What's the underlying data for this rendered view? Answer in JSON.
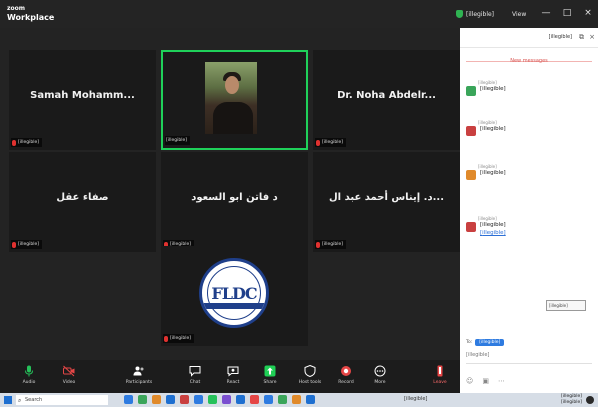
{
  "window": {
    "brand_line1": "zoom",
    "brand_line2": "Workplace",
    "status_text": "[illegible]",
    "view_label": "View",
    "minimize": "—",
    "maximize": "□",
    "close": "×"
  },
  "participants": [
    {
      "name": "Samah Mohamm...",
      "label": "[illegible]",
      "muted": true,
      "active": false
    },
    {
      "name": "",
      "label": "[illegible]",
      "muted": false,
      "active": true,
      "has_video": true
    },
    {
      "name": "Dr. Noha Abdelr...",
      "label": "[illegible]",
      "muted": true,
      "active": false
    },
    {
      "name": "صفاء عقل",
      "label": "[illegible]",
      "muted": true,
      "active": false
    },
    {
      "name": "د فاتن ابو السعود",
      "label": "[illegible]",
      "muted": true,
      "active": false
    },
    {
      "name": "د. إيناس أحمد عبد ال...",
      "label": "[illegible]",
      "muted": true,
      "active": false
    },
    {
      "name": "",
      "label": "[illegible]",
      "muted": true,
      "active": false,
      "logo_text": "FLDC"
    }
  ],
  "toolbar": [
    {
      "id": "audio",
      "label": "Audio",
      "icon": "microphone-icon",
      "color": "#25c15a"
    },
    {
      "id": "video",
      "label": "Video",
      "icon": "camera-icon",
      "color": "#e54646"
    },
    {
      "id": "participants",
      "label": "Participants",
      "icon": "participants-icon",
      "color": "#ffffff"
    },
    {
      "id": "chat",
      "label": "Chat",
      "icon": "chat-icon",
      "color": "#ffffff"
    },
    {
      "id": "react",
      "label": "React",
      "icon": "react-icon",
      "color": "#ffffff"
    },
    {
      "id": "share",
      "label": "Share",
      "icon": "share-icon",
      "color": "#1fcf55"
    },
    {
      "id": "host-tools",
      "label": "Host tools",
      "icon": "shield-icon",
      "color": "#ffffff"
    },
    {
      "id": "record",
      "label": "Record",
      "icon": "record-icon",
      "color": "#e54646"
    },
    {
      "id": "more",
      "label": "More",
      "icon": "more-icon",
      "color": "#ffffff"
    },
    {
      "id": "leave",
      "label": "Leave",
      "icon": "leave-icon",
      "color": "#e54646"
    }
  ],
  "chat": {
    "title": "[illegible]",
    "new_messages": "New messages",
    "messages": [
      {
        "meta": "[illegible]",
        "text": "[illegible]",
        "avatar_color": "#3aa55a",
        "avatar_text": ""
      },
      {
        "meta": "[illegible]",
        "text": "[illegible]",
        "avatar_color": "#c94040",
        "avatar_text": ""
      },
      {
        "meta": "[illegible]",
        "text": "[illegible]",
        "avatar_color": "#e08a2b",
        "avatar_text": ""
      },
      {
        "meta": "[illegible]",
        "text": "[illegible]",
        "avatar_color": "#c94040",
        "avatar_text": "",
        "link": "[illegible]"
      }
    ],
    "tooltip": "[illegible]",
    "to_label": "To:",
    "to_chip": "[illegible]",
    "input_text": "[illegible]",
    "tools": [
      "☺",
      "▣",
      "⋯"
    ]
  },
  "taskbar": {
    "search_placeholder": "Search",
    "tray": "[illegible]",
    "time": "[illegible]",
    "date": "[illegible]",
    "app_colors": [
      "#2e7be0",
      "#3aa55a",
      "#e08a2b",
      "#1e6fd0",
      "#c94040",
      "#2e7be0",
      "#25c15a",
      "#7a4fd0",
      "#1e6fd0",
      "#e54646",
      "#2e7be0",
      "#3aa55a",
      "#e08a2b",
      "#1e6fd0"
    ]
  },
  "placeholders": [
    "[illegible]"
  ]
}
